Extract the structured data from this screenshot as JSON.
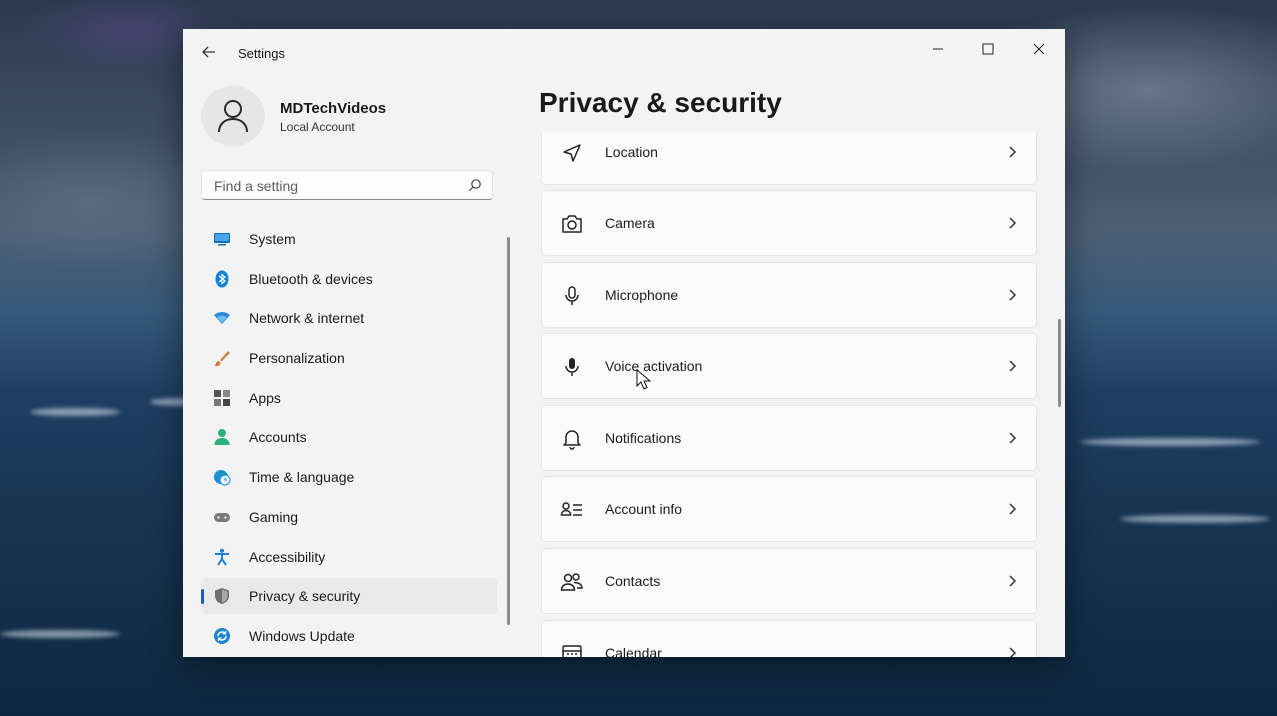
{
  "window": {
    "app_title": "Settings"
  },
  "profile": {
    "name": "MDTechVideos",
    "account_type": "Local Account"
  },
  "search": {
    "placeholder": "Find a setting"
  },
  "sidebar": {
    "items": [
      {
        "label": "System",
        "icon": "monitor-icon",
        "color": "#0f6cbd"
      },
      {
        "label": "Bluetooth & devices",
        "icon": "bluetooth-icon",
        "color": "#0a84d6"
      },
      {
        "label": "Network & internet",
        "icon": "wifi-icon",
        "color": "#2b88d8"
      },
      {
        "label": "Personalization",
        "icon": "brush-icon",
        "color": "#d9733a"
      },
      {
        "label": "Apps",
        "icon": "apps-icon",
        "color": "#555555"
      },
      {
        "label": "Accounts",
        "icon": "person-icon",
        "color": "#2bb07a"
      },
      {
        "label": "Time & language",
        "icon": "globe-clock-icon",
        "color": "#1c8fcf"
      },
      {
        "label": "Gaming",
        "icon": "controller-icon",
        "color": "#7a7a7a"
      },
      {
        "label": "Accessibility",
        "icon": "accessibility-icon",
        "color": "#1a7fd6"
      },
      {
        "label": "Privacy & security",
        "icon": "shield-icon",
        "color": "#6e6e6e",
        "active": true
      },
      {
        "label": "Windows Update",
        "icon": "update-icon",
        "color": "#1a86d0"
      }
    ]
  },
  "main": {
    "title": "Privacy & security",
    "items": [
      {
        "label": "Location",
        "icon": "location-icon"
      },
      {
        "label": "Camera",
        "icon": "camera-icon"
      },
      {
        "label": "Microphone",
        "icon": "microphone-icon"
      },
      {
        "label": "Voice activation",
        "icon": "voice-activation-icon"
      },
      {
        "label": "Notifications",
        "icon": "bell-icon"
      },
      {
        "label": "Account info",
        "icon": "account-info-icon"
      },
      {
        "label": "Contacts",
        "icon": "contacts-icon"
      },
      {
        "label": "Calendar",
        "icon": "calendar-icon"
      }
    ]
  }
}
